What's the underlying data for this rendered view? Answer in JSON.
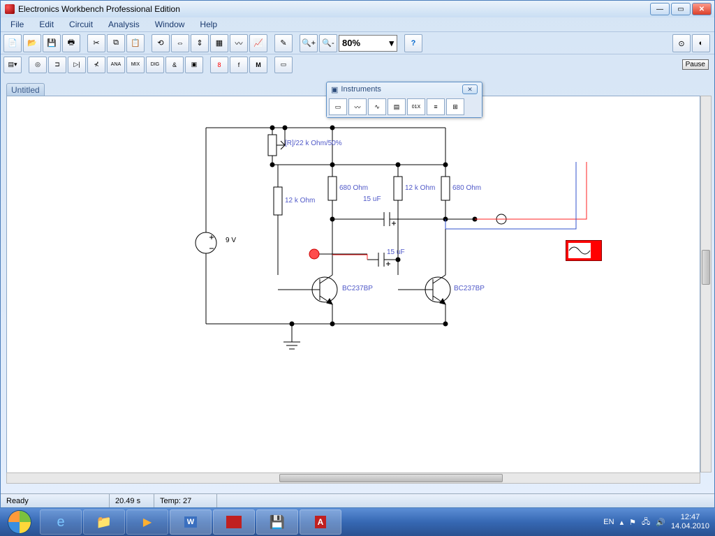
{
  "app": {
    "title": "Electronics Workbench Professional Edition"
  },
  "menu": {
    "items": [
      "File",
      "Edit",
      "Circuit",
      "Analysis",
      "Window",
      "Help"
    ]
  },
  "zoom": "80%",
  "document": {
    "tab": "Untitled"
  },
  "instruments": {
    "title": "Instruments"
  },
  "pause": "Pause",
  "circuit": {
    "source": "9 V",
    "pot": "[R]/22 k Ohm/50%",
    "r1": "12 k Ohm",
    "r2": "680  Ohm",
    "r3": "12 k Ohm",
    "r4": "680  Ohm",
    "c1": "15 uF",
    "c2": "15 uF",
    "q1": "BC237BP",
    "q2": "BC237BP"
  },
  "status": {
    "ready": "Ready",
    "time": "20.49 s",
    "temp": "Temp:  27"
  },
  "tray": {
    "lang": "EN",
    "time": "12:47",
    "date": "14.04.2010"
  }
}
